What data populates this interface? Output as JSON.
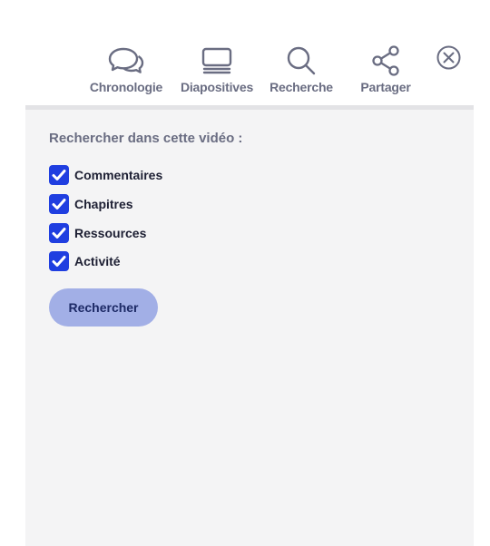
{
  "tabs": [
    {
      "id": "chronologie",
      "label": "Chronologie",
      "icon": "chat-bubbles-icon"
    },
    {
      "id": "diapositives",
      "label": "Diapositives",
      "icon": "slides-icon"
    },
    {
      "id": "recherche",
      "label": "Recherche",
      "icon": "search-icon",
      "active": true
    },
    {
      "id": "partager",
      "label": "Partager",
      "icon": "share-icon"
    }
  ],
  "close": {
    "icon": "close-circle-icon"
  },
  "search_panel": {
    "heading": "Rechercher dans cette vidéo :",
    "options": [
      {
        "label": "Commentaires",
        "checked": true
      },
      {
        "label": "Chapitres",
        "checked": true
      },
      {
        "label": "Ressources",
        "checked": true
      },
      {
        "label": "Activité",
        "checked": true
      }
    ],
    "submit_label": "Rechercher"
  },
  "colors": {
    "accent": "#1f3ee0",
    "active_indicator": "#23244a",
    "button_bg": "#a2afe6",
    "panel_bg": "#f4f4f5",
    "tab_text": "#6a6d82"
  }
}
